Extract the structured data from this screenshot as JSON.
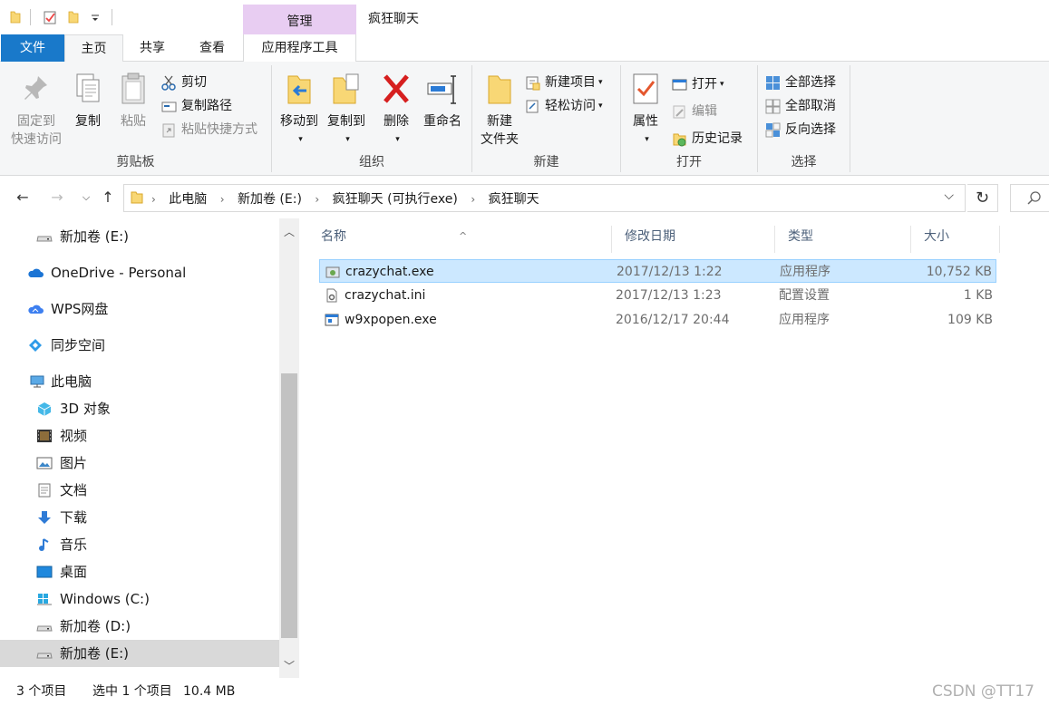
{
  "title_bar": {
    "context_group": "管理",
    "window_title": "疯狂聊天"
  },
  "tabs": {
    "file": "文件",
    "home": "主页",
    "share": "共享",
    "view": "查看",
    "app_tools": "应用程序工具"
  },
  "ribbon": {
    "clipboard": {
      "label": "剪贴板",
      "pin_line1": "固定到",
      "pin_line2": "快速访问",
      "copy": "复制",
      "paste": "粘贴",
      "cut": "剪切",
      "copy_path": "复制路径",
      "paste_shortcut": "粘贴快捷方式"
    },
    "organize": {
      "label": "组织",
      "move_to": "移动到",
      "copy_to": "复制到",
      "delete": "删除",
      "rename": "重命名"
    },
    "new": {
      "label": "新建",
      "new_folder_line1": "新建",
      "new_folder_line2": "文件夹",
      "new_item": "新建项目",
      "easy_access": "轻松访问"
    },
    "open": {
      "label": "打开",
      "properties": "属性",
      "open": "打开",
      "edit": "编辑",
      "history": "历史记录"
    },
    "select": {
      "label": "选择",
      "select_all": "全部选择",
      "select_none": "全部取消",
      "invert": "反向选择"
    }
  },
  "address": {
    "crumbs": [
      "此电脑",
      "新加卷 (E:)",
      "疯狂聊天 (可执行exe)",
      "疯狂聊天"
    ]
  },
  "sidebar": {
    "items": [
      {
        "label": "新加卷 (E:)"
      },
      {
        "label": "OneDrive - Personal"
      },
      {
        "label": "WPS网盘"
      },
      {
        "label": "同步空间"
      },
      {
        "label": "此电脑"
      },
      {
        "label": "3D 对象"
      },
      {
        "label": "视频"
      },
      {
        "label": "图片"
      },
      {
        "label": "文档"
      },
      {
        "label": "下载"
      },
      {
        "label": "音乐"
      },
      {
        "label": "桌面"
      },
      {
        "label": "Windows (C:)"
      },
      {
        "label": "新加卷 (D:)"
      },
      {
        "label": "新加卷 (E:)"
      }
    ]
  },
  "columns": {
    "name": "名称",
    "date": "修改日期",
    "type": "类型",
    "size": "大小"
  },
  "files": [
    {
      "name": "crazychat.exe",
      "date": "2017/12/13 1:22",
      "type": "应用程序",
      "size": "10,752 KB"
    },
    {
      "name": "crazychat.ini",
      "date": "2017/12/13 1:23",
      "type": "配置设置",
      "size": "1 KB"
    },
    {
      "name": "w9xpopen.exe",
      "date": "2016/12/17 20:44",
      "type": "应用程序",
      "size": "109 KB"
    }
  ],
  "status": {
    "count": "3 个项目",
    "selected": "选中 1 个项目",
    "selected_size": "10.4 MB",
    "watermark": "CSDN @TT17"
  },
  "colors": {
    "file_tab": "#1979ca",
    "context_group": "#e8cdf2",
    "selection": "#cce8ff",
    "folder_yellow": "#f8d775"
  }
}
